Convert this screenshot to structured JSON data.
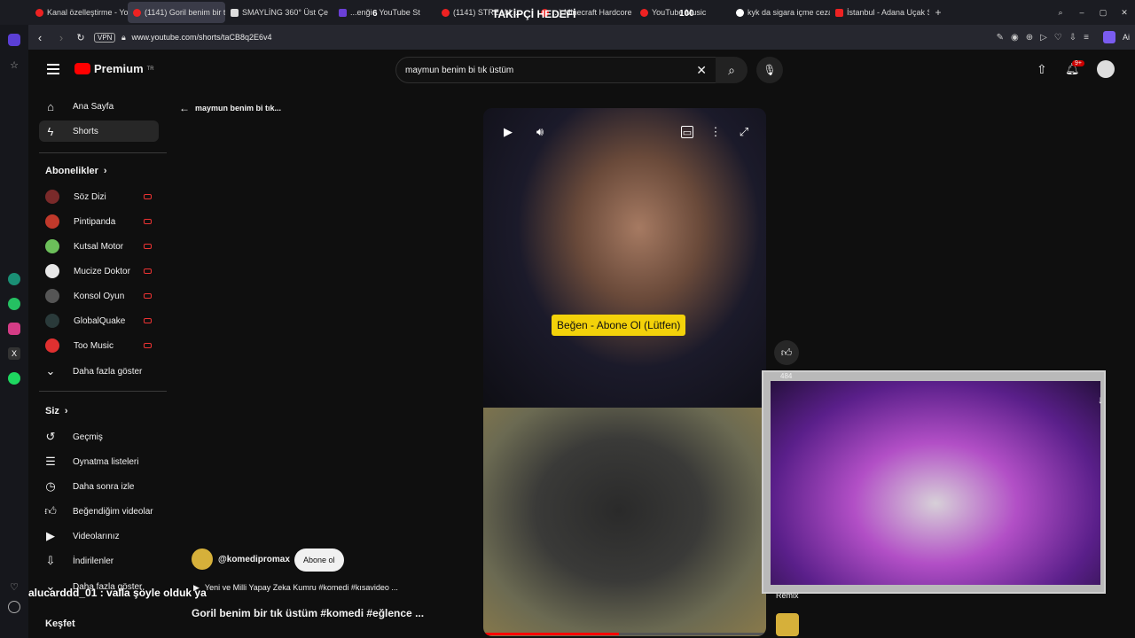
{
  "tabs": [
    {
      "label": "Kanal özelleştirme - YouTu"
    },
    {
      "label": "(1141) Goril benim bir tık"
    },
    {
      "label": "SMAYLİNG 360° Üst Çekim"
    },
    {
      "label": "...enği - YouTube St"
    },
    {
      "label": "(1141) STREAM..."
    },
    {
      "label": "...) Minecraft Hardcore"
    },
    {
      "label": "YouTube Music"
    },
    {
      "label": "kyk da sigara içme cezası"
    },
    {
      "label": "İstanbul - Adana Uçak Sefe"
    }
  ],
  "overlay": {
    "follower_goal": "TAKİPÇİ HEDEFİ",
    "goal_left": "6",
    "goal_right": "100"
  },
  "address": {
    "vpn": "VPN",
    "url": "www.youtube.com/shorts/taCB8q2E6v4",
    "ai_label": "Ai"
  },
  "header": {
    "logo": "Premium",
    "logo_sup": "TR",
    "search_value": "maymun benim bi tık üstüm",
    "notif_count": "9+"
  },
  "sidebar": {
    "home": "Ana Sayfa",
    "shorts": "Shorts",
    "subs_title": "Abonelikler",
    "subscriptions": [
      {
        "name": "Söz Dizi",
        "color": "#7a2a2a"
      },
      {
        "name": "Pintipanda",
        "color": "#c0392b"
      },
      {
        "name": "Kutsal Motor",
        "color": "#6cbf5a"
      },
      {
        "name": "Mucize Doktor",
        "color": "#e8e8e8"
      },
      {
        "name": "Konsol Oyun",
        "color": "#555"
      },
      {
        "name": "GlobalQuake",
        "color": "#2a3a3a"
      },
      {
        "name": "Too Music",
        "color": "#e03030"
      }
    ],
    "show_more": "Daha fazla göster",
    "you_title": "Siz",
    "you_items": [
      {
        "label": "Geçmiş",
        "icon": "history-icon"
      },
      {
        "label": "Oynatma listeleri",
        "icon": "playlist-icon"
      },
      {
        "label": "Daha sonra izle",
        "icon": "watch-later-icon"
      },
      {
        "label": "Beğendiğim videolar",
        "icon": "like-icon"
      },
      {
        "label": "Videolarınız",
        "icon": "your-videos-icon"
      },
      {
        "label": "İndirilenler",
        "icon": "download-icon"
      }
    ],
    "show_more2": "Daha fazla göster",
    "explore": "Keşfet"
  },
  "short": {
    "back_label": "maymun benim bi tık...",
    "caption": "Beğen - Abone Ol (Lütfen)",
    "like_count": "484",
    "channel": "@komedipromax",
    "subscribe": "Abone ol",
    "music_line": "Yeni ve Milli Yapay Zeka Kumru #komedi #kısavideo ...",
    "title": "Goril benim bir tık üstüm #komedi #eğlence ...",
    "remix": "Remix"
  },
  "chat": {
    "message": "alucarddd_01 : valla şöyle olduk ya"
  }
}
